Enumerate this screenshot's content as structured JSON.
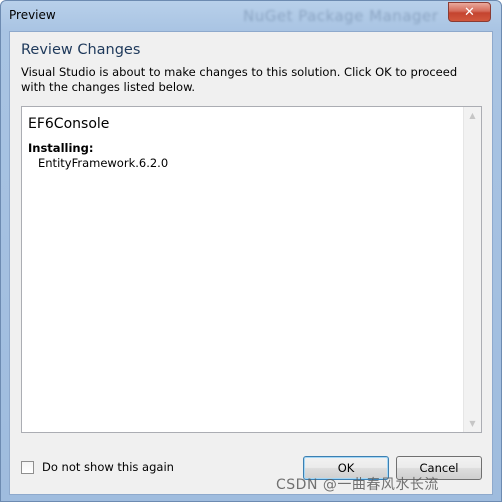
{
  "window": {
    "title": "Preview",
    "background_title": "NuGet Package Manager",
    "close_symbol": "✕"
  },
  "dialog": {
    "heading": "Review Changes",
    "description": "Visual Studio is about to make changes to this solution. Click OK to proceed with the changes listed below."
  },
  "changes": {
    "project": "EF6Console",
    "section_label": "Installing:",
    "packages": [
      "EntityFramework.6.2.0"
    ]
  },
  "footer": {
    "checkbox_label": "Do not show this again",
    "checkbox_checked": false,
    "ok_label": "OK",
    "cancel_label": "Cancel"
  },
  "watermark": "CSDN @一曲春风水长流",
  "colors": {
    "accent": "#1e395b",
    "close_button": "#c4442f"
  },
  "icons": {
    "close": "close-icon",
    "scroll_up": "scroll-up-arrow-icon",
    "scroll_down": "scroll-down-arrow-icon"
  }
}
